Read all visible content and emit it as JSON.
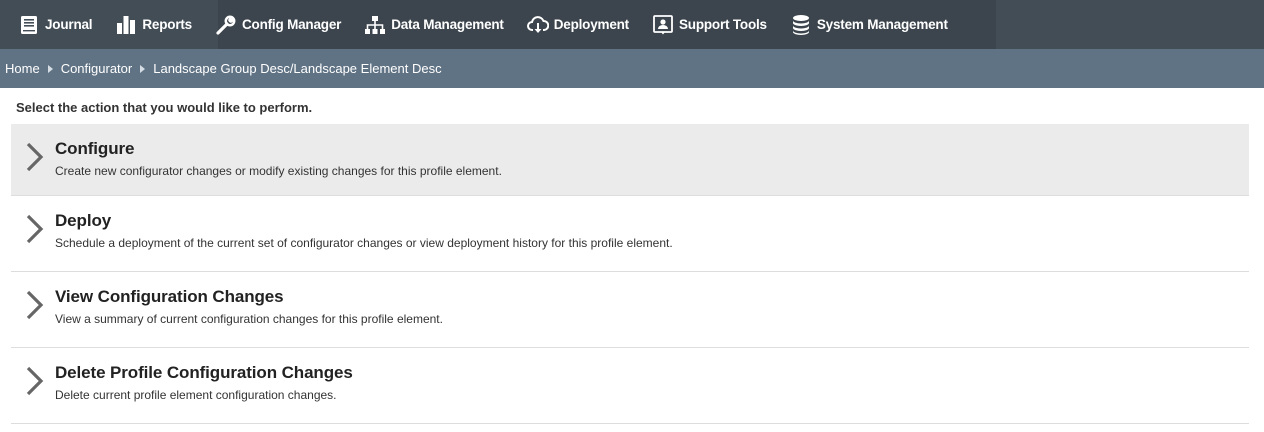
{
  "nav": {
    "items": [
      {
        "label": "Journal",
        "icon": "book-icon"
      },
      {
        "label": "Reports",
        "icon": "bar-chart-icon"
      },
      {
        "label": "Config Manager",
        "icon": "wrench-icon"
      },
      {
        "label": "Data Management",
        "icon": "hierarchy-icon"
      },
      {
        "label": "Deployment",
        "icon": "cloud-download-icon"
      },
      {
        "label": "Support Tools",
        "icon": "support-user-icon"
      },
      {
        "label": "System Management",
        "icon": "database-icon"
      }
    ]
  },
  "breadcrumb": {
    "items": [
      "Home",
      "Configurator",
      "Landscape Group Desc/Landscape Element Desc"
    ]
  },
  "main": {
    "prompt": "Select the action that you would like to perform.",
    "actions": [
      {
        "title": "Configure",
        "description": "Create new configurator changes or modify existing changes for this profile element."
      },
      {
        "title": "Deploy",
        "description": "Schedule a deployment of the current set of configurator changes or view deployment history for this profile element."
      },
      {
        "title": "View Configuration Changes",
        "description": "View a summary of current configuration changes for this profile element."
      },
      {
        "title": "Delete Profile Configuration Changes",
        "description": "Delete current profile element configuration changes."
      }
    ]
  },
  "colors": {
    "nav_bg": "#434d56",
    "breadcrumb_bg": "#607384",
    "active_row_bg": "#ebebeb"
  }
}
